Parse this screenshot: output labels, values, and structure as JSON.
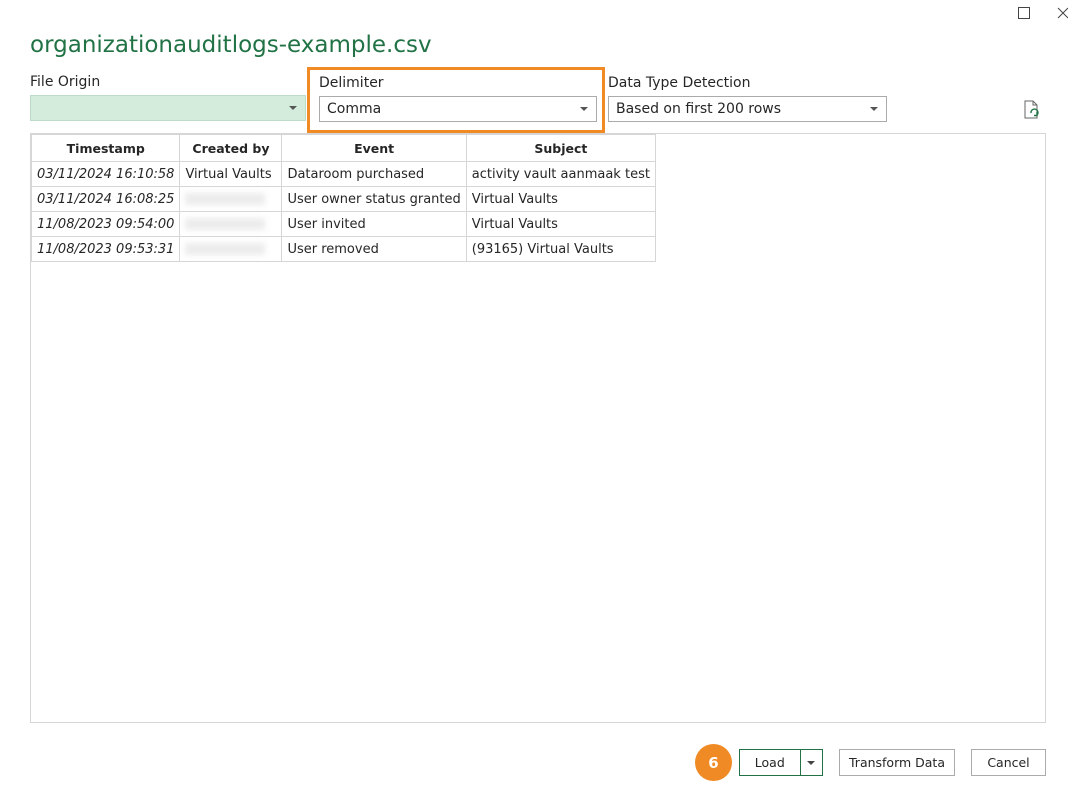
{
  "dialog": {
    "title": "organizationauditlogs-example.csv"
  },
  "window_controls": {
    "maximize_icon": "maximize-icon",
    "close_icon": "close-icon"
  },
  "file_origin": {
    "label": "File Origin",
    "value": ""
  },
  "delimiter": {
    "label": "Delimiter",
    "value": "Comma"
  },
  "data_type_detection": {
    "label": "Data Type Detection",
    "value": "Based on first 200 rows"
  },
  "preview_table": {
    "columns": [
      "Timestamp",
      "Created by",
      "Event",
      "Subject"
    ],
    "rows": [
      {
        "timestamp": "03/11/2024 16:10:58",
        "created_by": "Virtual Vaults",
        "event": "Dataroom purchased",
        "subject": "activity vault aanmaak test"
      },
      {
        "timestamp": "03/11/2024 16:08:25",
        "created_by": "",
        "event": "User owner status granted",
        "subject": "Virtual Vaults"
      },
      {
        "timestamp": "11/08/2023 09:54:00",
        "created_by": "",
        "event": "User invited",
        "subject": "Virtual Vaults"
      },
      {
        "timestamp": "11/08/2023 09:53:31",
        "created_by": "",
        "event": "User removed",
        "subject": "(93165) Virtual Vaults"
      }
    ]
  },
  "buttons": {
    "load": "Load",
    "transform": "Transform Data",
    "cancel": "Cancel"
  },
  "step_badge": "6",
  "colors": {
    "accent_green": "#217346",
    "highlight_orange": "#f08a24",
    "file_origin_fill": "#d4ecdc"
  }
}
